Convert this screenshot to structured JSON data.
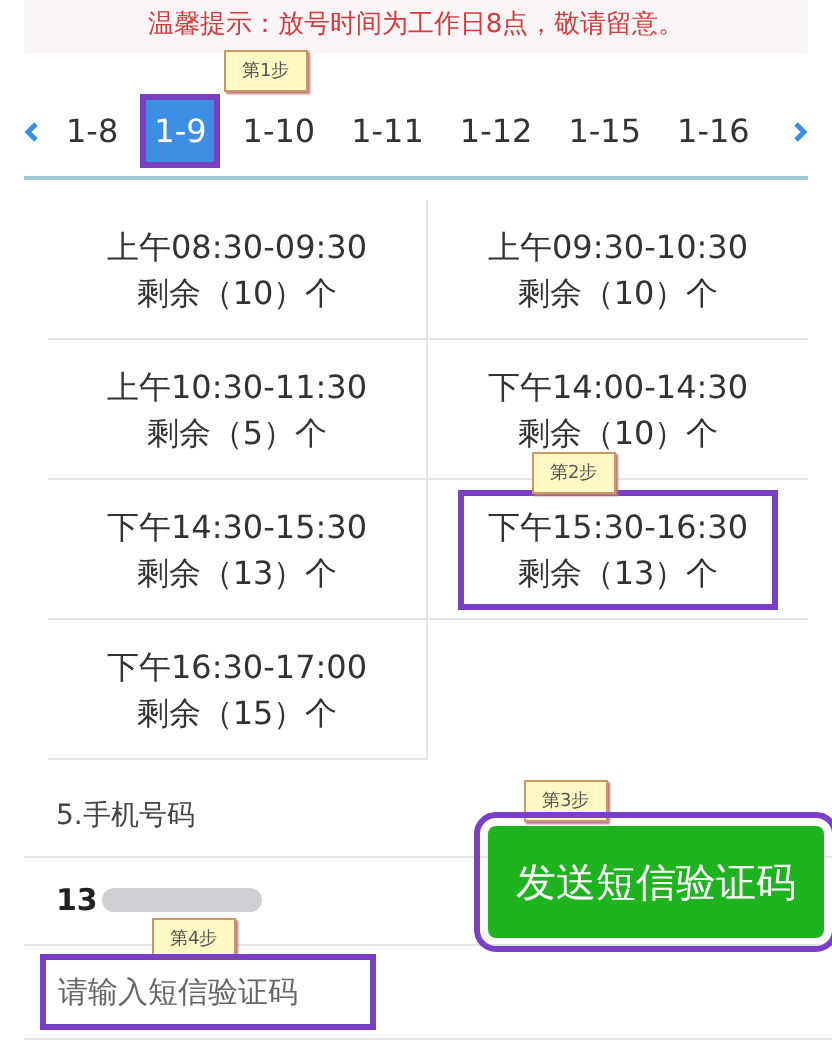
{
  "notice": "温馨提示：放号时间为工作日8点，敬请留意。",
  "dates": [
    {
      "label": "1-8",
      "selected": false
    },
    {
      "label": "1-9",
      "selected": true
    },
    {
      "label": "1-10",
      "selected": false
    },
    {
      "label": "1-11",
      "selected": false
    },
    {
      "label": "1-12",
      "selected": false
    },
    {
      "label": "1-15",
      "selected": false
    },
    {
      "label": "1-16",
      "selected": false
    }
  ],
  "slots": [
    {
      "time": "上午08:30-09:30",
      "remaining": "剩余（10）个",
      "selected": false
    },
    {
      "time": "上午09:30-10:30",
      "remaining": "剩余（10）个",
      "selected": false
    },
    {
      "time": "上午10:30-11:30",
      "remaining": "剩余（5）个",
      "selected": false
    },
    {
      "time": "下午14:00-14:30",
      "remaining": "剩余（10）个",
      "selected": false
    },
    {
      "time": "下午14:30-15:30",
      "remaining": "剩余（13）个",
      "selected": false
    },
    {
      "time": "下午15:30-16:30",
      "remaining": "剩余（13）个",
      "selected": true
    },
    {
      "time": "下午16:30-17:00",
      "remaining": "剩余（15）个",
      "selected": false
    }
  ],
  "phone": {
    "label": "5.手机号码",
    "value": "13"
  },
  "send_button": "发送短信验证码",
  "code_field": {
    "placeholder": "请输入短信验证码"
  },
  "steps": [
    "第1步",
    "第2步",
    "第3步",
    "第4步"
  ]
}
